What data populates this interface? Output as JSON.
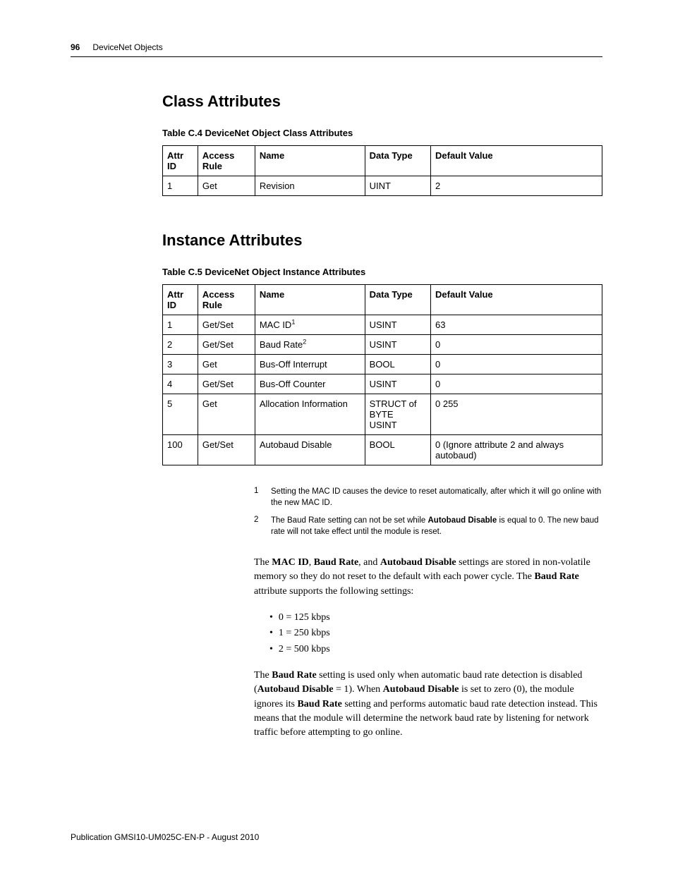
{
  "header": {
    "page_number": "96",
    "topic": "DeviceNet Objects"
  },
  "class_section": {
    "heading": "Class Attributes",
    "caption": "Table C.4 DeviceNet Object Class Attributes",
    "columns": [
      "Attr ID",
      "Access Rule",
      "Name",
      "Data Type",
      "Default Value"
    ],
    "rows": [
      {
        "id": "1",
        "access": "Get",
        "name": "Revision",
        "dtype": "UINT",
        "def": "2"
      }
    ]
  },
  "instance_section": {
    "heading": "Instance Attributes",
    "caption": "Table C.5 DeviceNet Object Instance Attributes",
    "columns": [
      "Attr ID",
      "Access Rule",
      "Name",
      "Data Type",
      "Default Value"
    ],
    "rows": [
      {
        "id": "1",
        "access": "Get/Set",
        "name": "MAC ID",
        "sup": "1",
        "dtype": "USINT",
        "def": "63"
      },
      {
        "id": "2",
        "access": "Get/Set",
        "name": "Baud Rate",
        "sup": "2",
        "dtype": "USINT",
        "def": "0"
      },
      {
        "id": "3",
        "access": "Get",
        "name": "Bus-Off Interrupt",
        "dtype": "BOOL",
        "def": "0"
      },
      {
        "id": "4",
        "access": "Get/Set",
        "name": "Bus-Off Counter",
        "dtype": "USINT",
        "def": "0"
      },
      {
        "id": "5",
        "access": "Get",
        "name": "Allocation Information",
        "dtype": "STRUCT of BYTE USINT",
        "def": "0 255"
      },
      {
        "id": "100",
        "access": "Get/Set",
        "name": "Autobaud Disable",
        "dtype": "BOOL",
        "def": "0 (Ignore attribute 2 and always autobaud)"
      }
    ]
  },
  "footnotes": [
    {
      "num": "1",
      "text_before": "Setting the MAC ID causes the device to reset automatically, after which it will go online with the new MAC ID."
    },
    {
      "num": "2",
      "text_before": "The Baud Rate setting can not be set while ",
      "bold": "Autobaud Disable",
      "text_after": " is equal to 0. The new baud rate will not take effect until the module is reset."
    }
  ],
  "para1": {
    "p1": "The ",
    "b1": "MAC ID",
    "p2": ", ",
    "b2": "Baud Rate",
    "p3": ", and ",
    "b3": "Autobaud Disable",
    "p4": " settings are stored in non-volatile memory so they do not reset to the default with each power cycle. The ",
    "b4": "Baud Rate",
    "p5": " attribute supports the following settings:"
  },
  "bullets": [
    "0 = 125 kbps",
    "1 = 250 kbps",
    "2 = 500 kbps"
  ],
  "para2": {
    "p1": "The ",
    "b1": "Baud Rate",
    "p2": " setting is used only when automatic baud rate detection is disabled (",
    "b2": "Autobaud Disable",
    "p3": " = 1). When ",
    "b3": "Autobaud Disable",
    "p4": " is set to zero (0), the module ignores its ",
    "b4": "Baud Rate",
    "p5": " setting and performs automatic baud rate detection instead. This means that the module will determine the network baud rate by listening for network traffic before attempting to go online."
  },
  "footer": "Publication GMSI10-UM025C-EN-P - August 2010"
}
